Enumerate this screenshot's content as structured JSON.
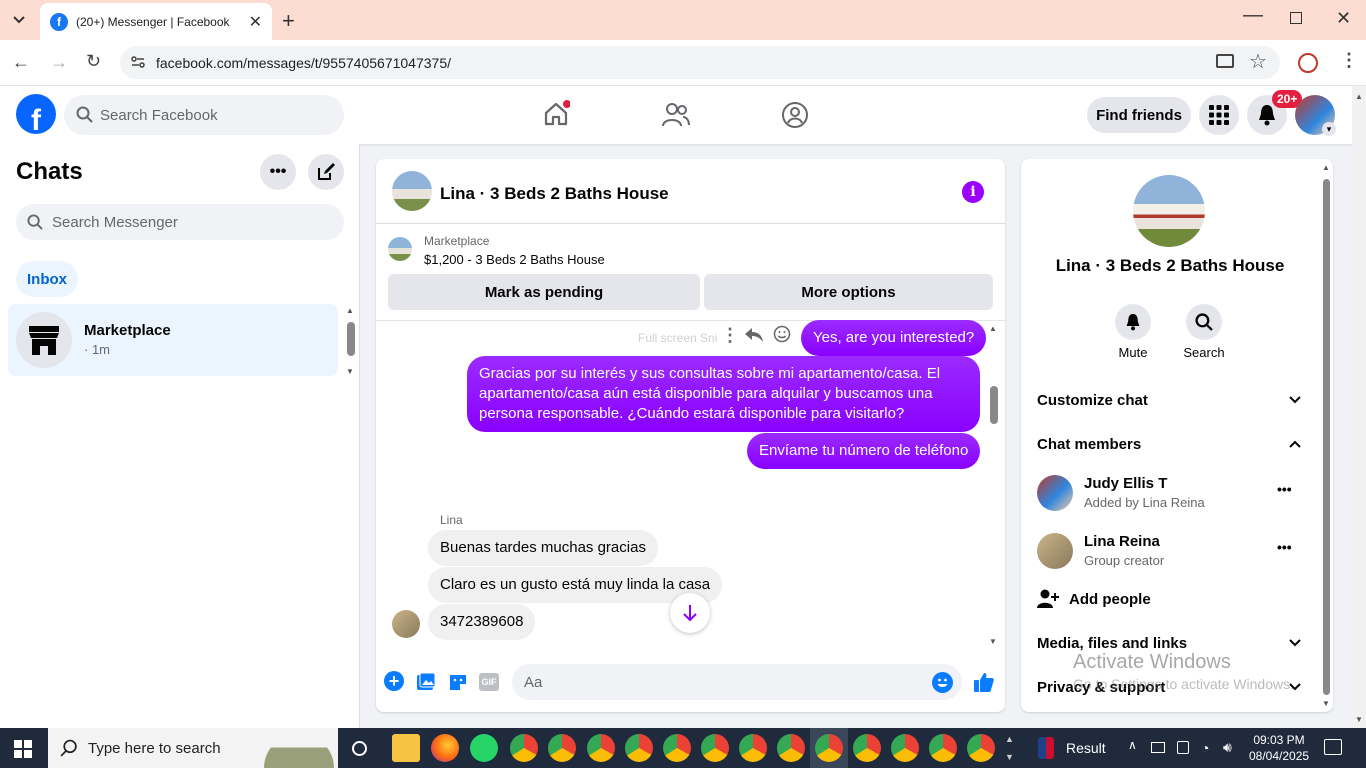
{
  "browser": {
    "tab_title": "(20+) Messenger | Facebook",
    "url": "facebook.com/messages/t/9557405671047375/"
  },
  "fb_header": {
    "search_placeholder": "Search Facebook",
    "find_friends": "Find friends",
    "notif_badge": "20+"
  },
  "left": {
    "title": "Chats",
    "search_placeholder": "Search Messenger",
    "inbox_label": "Inbox",
    "conversation": {
      "name": "Marketplace",
      "time": "· 1m"
    }
  },
  "chat": {
    "title": "Lina · 3 Beds 2 Baths House",
    "marketplace_label": "Marketplace",
    "listing": "$1,200 - 3 Beds 2 Baths House",
    "mark_pending": "Mark as pending",
    "more_options": "More options",
    "ghost_text": "Full screen Sni",
    "messages_out": [
      "Yes, are you interested?",
      "Gracias por su interés y sus consultas sobre mi apartamento/casa. El apartamento/casa aún está disponible para alquilar y buscamos una persona responsable. ¿Cuándo estará disponible para visitarlo?",
      "Envíame tu número de teléfono"
    ],
    "sender": "Lina",
    "messages_in": [
      "Buenas tardes muchas gracias",
      "Claro es un gusto está muy linda la casa",
      "3472389608"
    ],
    "composer_placeholder": "Aa"
  },
  "right": {
    "name": "Lina · 3 Beds 2 Baths House",
    "mute": "Mute",
    "search": "Search",
    "customize": "Customize chat",
    "members_header": "Chat members",
    "members": [
      {
        "name": "Judy Ellis T",
        "sub": "Added by Lina Reina"
      },
      {
        "name": "Lina Reina",
        "sub": "Group creator"
      }
    ],
    "add_people": "Add people",
    "media": "Media, files and links",
    "privacy": "Privacy & support",
    "watermark_title": "Activate Windows",
    "watermark_sub": "Go to Settings to activate Windows."
  },
  "taskbar": {
    "search_placeholder": "Type here to search",
    "result": "Result",
    "time": "09:03 PM",
    "date": "08/04/2025"
  },
  "colors": {
    "fb_blue": "#0866ff",
    "bubble_purple": "#8a00ff",
    "taskbar": "#1f2b3d"
  }
}
